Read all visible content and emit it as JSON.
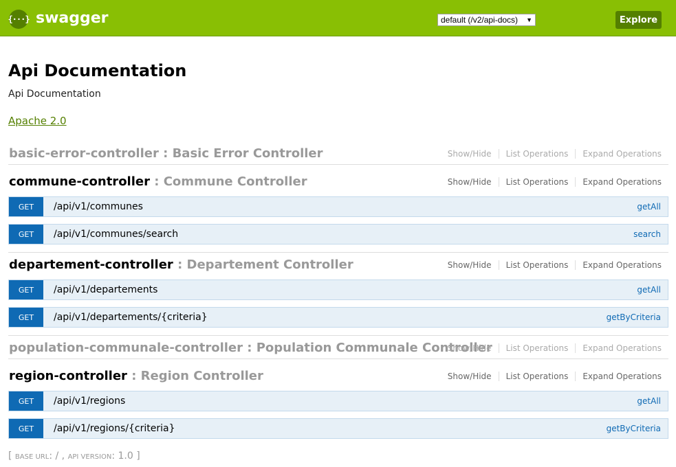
{
  "header": {
    "logo_glyph": "{···}",
    "brand": "swagger",
    "spec_selected": "default (/v2/api-docs)",
    "explore_label": "Explore",
    "colors": {
      "bar": "#89bf04",
      "accent": "#547f00"
    }
  },
  "info": {
    "title": "Api Documentation",
    "description": "Api Documentation",
    "license": "Apache 2.0"
  },
  "ops_labels": {
    "show_hide": "Show/Hide",
    "list_operations": "List Operations",
    "expand_operations": "Expand Operations"
  },
  "resources": [
    {
      "name": "basic-error-controller",
      "description": " : Basic Error Controller",
      "muted": true,
      "endpoints": []
    },
    {
      "name": "commune-controller",
      "description": " : Commune Controller",
      "muted": false,
      "endpoints": [
        {
          "method": "GET",
          "path": "/api/v1/communes",
          "nickname": "getAll"
        },
        {
          "method": "GET",
          "path": "/api/v1/communes/search",
          "nickname": "search"
        }
      ]
    },
    {
      "name": "departement-controller",
      "description": " : Departement Controller",
      "muted": false,
      "endpoints": [
        {
          "method": "GET",
          "path": "/api/v1/departements",
          "nickname": "getAll"
        },
        {
          "method": "GET",
          "path": "/api/v1/departements/{criteria}",
          "nickname": "getByCriteria"
        }
      ]
    },
    {
      "name": "population-communale-controller",
      "description": " : Population Communale Controller",
      "muted": true,
      "endpoints": []
    },
    {
      "name": "region-controller",
      "description": " : Region Controller",
      "muted": false,
      "endpoints": [
        {
          "method": "GET",
          "path": "/api/v1/regions",
          "nickname": "getAll"
        },
        {
          "method": "GET",
          "path": "/api/v1/regions/{criteria}",
          "nickname": "getByCriteria"
        }
      ]
    }
  ],
  "footer": {
    "base_url_label": "base url",
    "base_url": "/",
    "api_version_label": "api version",
    "api_version": "1.0"
  }
}
